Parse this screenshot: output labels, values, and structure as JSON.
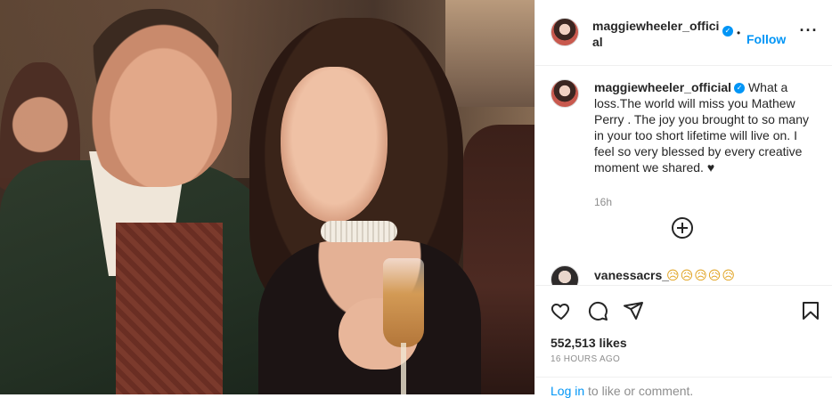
{
  "header": {
    "username": "maggiewheeler_official",
    "verified_badge": "verified-badge",
    "separator": "•",
    "follow_label": "Follow",
    "more_icon": "more-options-icon"
  },
  "caption": {
    "username": "maggiewheeler_official",
    "text": "What a loss.The world will miss you Mathew Perry . The joy you brought to so many in your too short lifetime will live on. I feel so very blessed by every creative moment we shared. ♥",
    "time": "16h"
  },
  "load_more_icon": "add-circle-icon",
  "comments": [
    {
      "username": "vanessacrs_",
      "text": "😥😥😥😥😥"
    }
  ],
  "actions": {
    "like_icon": "heart-icon",
    "comment_icon": "comment-icon",
    "share_icon": "share-icon",
    "save_icon": "bookmark-icon"
  },
  "likes": "552,513 likes",
  "posted": "16 HOURS AGO",
  "login": {
    "link_label": "Log in",
    "suffix": " to like or comment."
  },
  "colors": {
    "accent": "#0095f6",
    "text": "#262626",
    "muted": "#8e8e8e",
    "border": "#efefef"
  }
}
